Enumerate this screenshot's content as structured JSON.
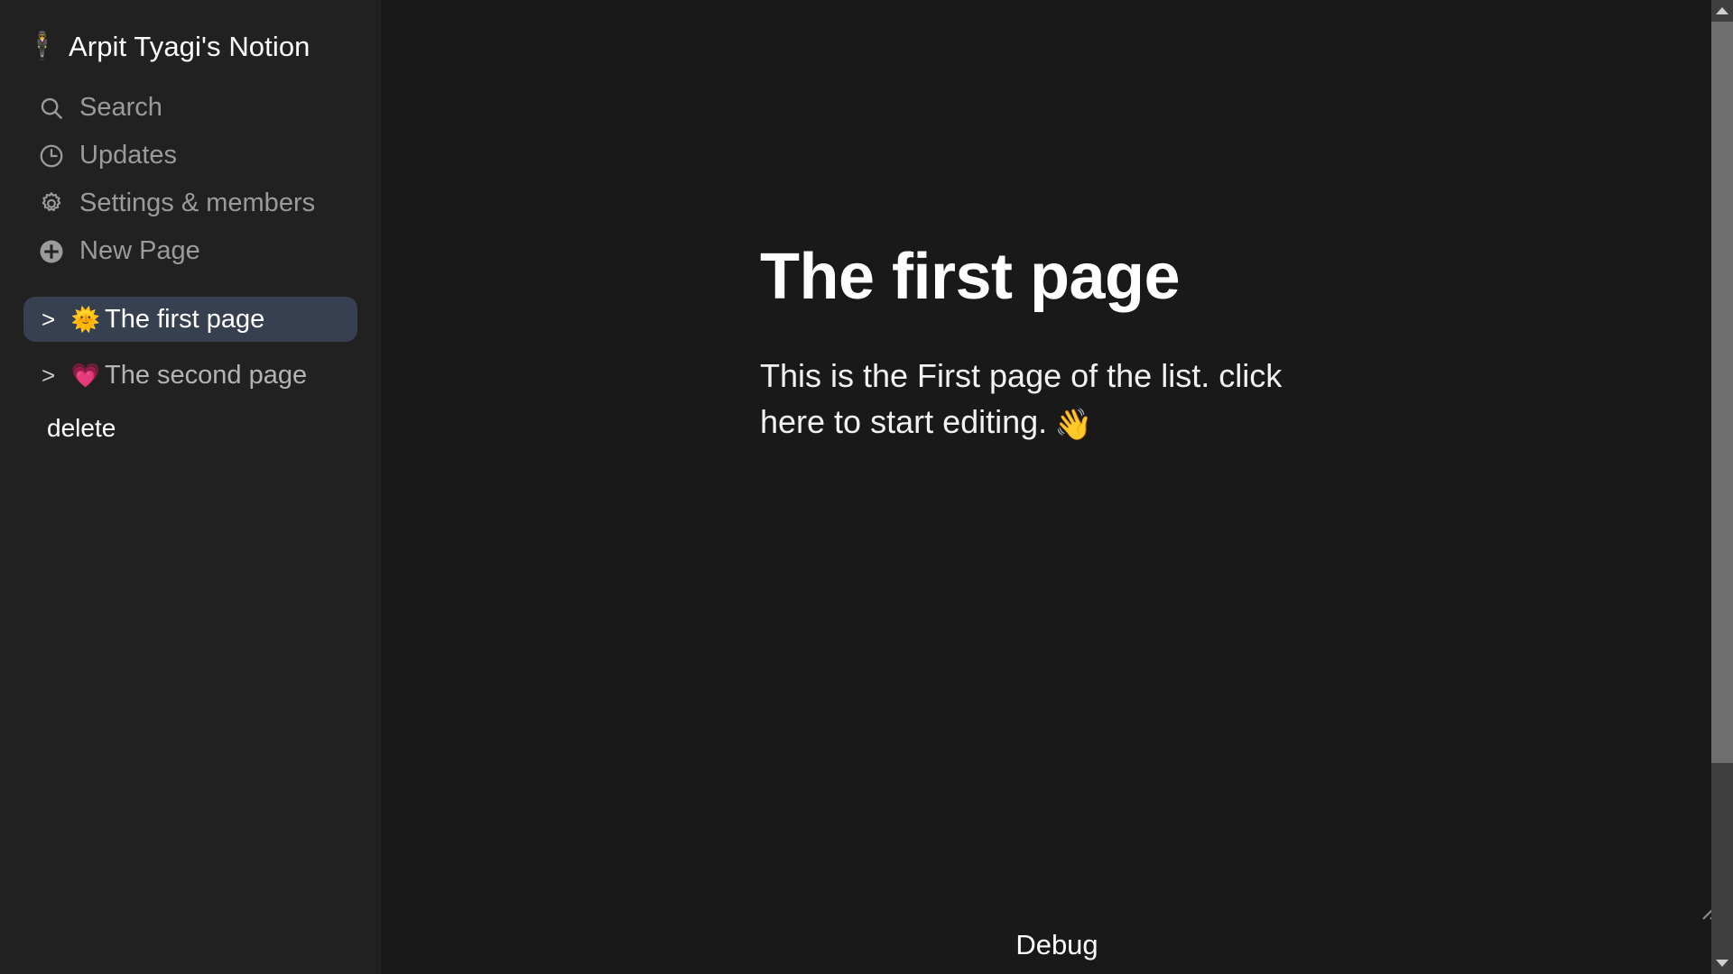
{
  "colors": {
    "sidebar_bg": "#212121",
    "main_bg": "#191919",
    "active_item_bg": "#374050",
    "muted_text": "#9b9b9b",
    "primary_text": "#ffffff",
    "scrollbar_track": "#3f3f3f",
    "scrollbar_thumb": "#6e6e6e"
  },
  "sidebar": {
    "workspace": {
      "emoji": "🕴️",
      "emoji_name": "person-in-suit-emoji",
      "title": "Arpit Tyagi's Notion"
    },
    "nav_items": [
      {
        "icon": "search-icon",
        "label": "Search"
      },
      {
        "icon": "clock-icon",
        "label": "Updates"
      },
      {
        "icon": "gear-icon",
        "label": "Settings & members"
      },
      {
        "icon": "plus-circle-icon",
        "label": "New Page"
      }
    ],
    "pages": [
      {
        "chevron": ">",
        "emoji": "🌞",
        "emoji_name": "sun-with-face-emoji",
        "label": "The first page",
        "active": true
      },
      {
        "chevron": ">",
        "emoji": "💗",
        "emoji_name": "growing-heart-emoji",
        "label": "The second page",
        "active": false
      }
    ],
    "delete_label": "delete"
  },
  "main": {
    "title": "The first page",
    "paragraph": "This is the First page of the list. click here to start editing.",
    "paragraph_emoji": "👋",
    "paragraph_emoji_name": "waving-hand-emoji"
  },
  "footer": {
    "debug_label": "Debug"
  },
  "scrollbar": {
    "up_arrow": "▲",
    "down_arrow": "▼"
  }
}
